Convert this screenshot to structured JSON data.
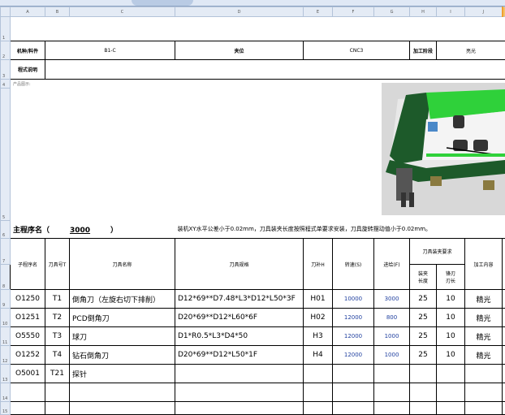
{
  "toolbar": {
    "tab_label": "B1-C"
  },
  "columns": [
    "A",
    "B",
    "C",
    "D",
    "E",
    "F",
    "G",
    "H",
    "I",
    "J"
  ],
  "rows": [
    "1",
    "2",
    "3",
    "4",
    "5",
    "6",
    "7",
    "8",
    "9",
    "10",
    "11",
    "12",
    "13",
    "14",
    "15"
  ],
  "header": {
    "machine_label": "机种/料件",
    "machine_value": "B1-C",
    "fixture_label": "夹位",
    "machine_no": "CNC3",
    "process_label": "加工阶段",
    "process_value": "亮光",
    "program_note_label": "程式说明"
  },
  "product_label": "产品图示:",
  "main_program": {
    "label": "主程序名（",
    "number": "3000",
    "close": "）",
    "note": "装机XY水平公差小于0.02mm，刀具装夹长度按照程式单要求安装，刀具旋转摆动值小于0.02mm。"
  },
  "table_headers": {
    "sub_program": "子程序名",
    "tool_no": "刀具号T",
    "tool_name": "刀具名称",
    "tool_spec": "刀具规格",
    "tool_comp": "刀补H",
    "speed": "转速(S)",
    "feed": "进给(F)",
    "clamp_req": "刀具装夹要求",
    "clamp_len": "装夹长度",
    "cut_edge": "锋刃刃长",
    "content": "加工内容"
  },
  "tools": [
    {
      "prog": "O1250",
      "t": "T1",
      "name": "倒角刀（左旋右切下排削）",
      "spec": "D12*69**D7.48*L3*D12*L50*3F",
      "h": "H01",
      "s": "10000",
      "f": "3000",
      "len": "25",
      "edge": "10",
      "content": "精光"
    },
    {
      "prog": "O1251",
      "t": "T2",
      "name": "PCD倒角刀",
      "spec": "D20*69**D12*L60*6F",
      "h": "H02",
      "s": "12000",
      "f": "800",
      "len": "25",
      "edge": "10",
      "content": "精光"
    },
    {
      "prog": "O5550",
      "t": "T3",
      "name": "球刀",
      "spec": "D1*R0.5*L3*D4*50",
      "h": "H3",
      "s": "12000",
      "f": "1000",
      "len": "25",
      "edge": "10",
      "content": "精光"
    },
    {
      "prog": "O1252",
      "t": "T4",
      "name": "钻石倒角刀",
      "spec": "D20*69**D12*L50*1F",
      "h": "H4",
      "s": "12000",
      "f": "1000",
      "len": "25",
      "edge": "10",
      "content": "精光"
    },
    {
      "prog": "O5001",
      "t": "T21",
      "name": "探针",
      "spec": "",
      "h": "",
      "s": "",
      "f": "",
      "len": "",
      "edge": "",
      "content": ""
    }
  ]
}
